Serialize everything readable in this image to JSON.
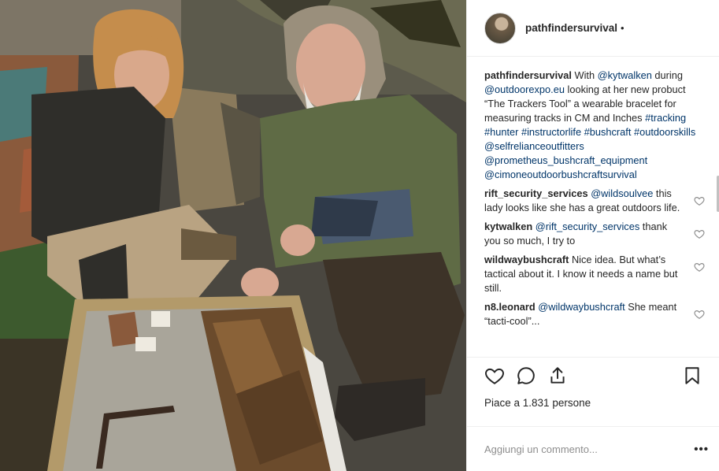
{
  "header": {
    "username": "pathfindersurvival",
    "separator": "•"
  },
  "caption": {
    "username": "pathfindersurvival",
    "t1": " With ",
    "m1": "@kytwalken",
    "t2": " during ",
    "m2": "@outdoorexpo.eu",
    "t3": " looking at her new probuct “The Trackers Tool” a wearable bracelet for measuring tracks in CM and Inches ",
    "h1": "#tracking",
    "h2": "#hunter",
    "h3": "#instructorlife",
    "h4": "#bushcraft",
    "h5": "#outdoorskills",
    "m3": "@selfrelianceoutfitters",
    "m4": "@prometheus_bushcraft_equipment",
    "m5": "@cimoneoutdoorbushcraftsurvival"
  },
  "comments": [
    {
      "username": "rift_security_services",
      "mention": "@wildsoulvee",
      "text": "this lady looks like she has a great outdoors life."
    },
    {
      "username": "kytwalken",
      "mention": "@rift_security_services",
      "text": "thank you so much, I try to"
    },
    {
      "username": "wildwaybushcraft",
      "mention": "",
      "text": "Nice idea. But what’s tactical about it. I know it needs a name but still."
    },
    {
      "username": "n8.leonard",
      "mention": "@wildwaybushcraft",
      "text": "She meant “tacti-cool”..."
    }
  ],
  "likes": {
    "text": "Piace a 1.831 persone"
  },
  "add_comment": {
    "placeholder": "Aggiungi un commento...",
    "more": "•••"
  },
  "icons": {
    "like": "heart-icon",
    "comment": "comment-bubble-icon",
    "share": "share-icon",
    "save": "bookmark-icon",
    "comment_like": "heart-icon"
  },
  "colors": {
    "link": "#003569",
    "text": "#262626",
    "muted": "#8e8e8e",
    "divider": "#efefef"
  }
}
